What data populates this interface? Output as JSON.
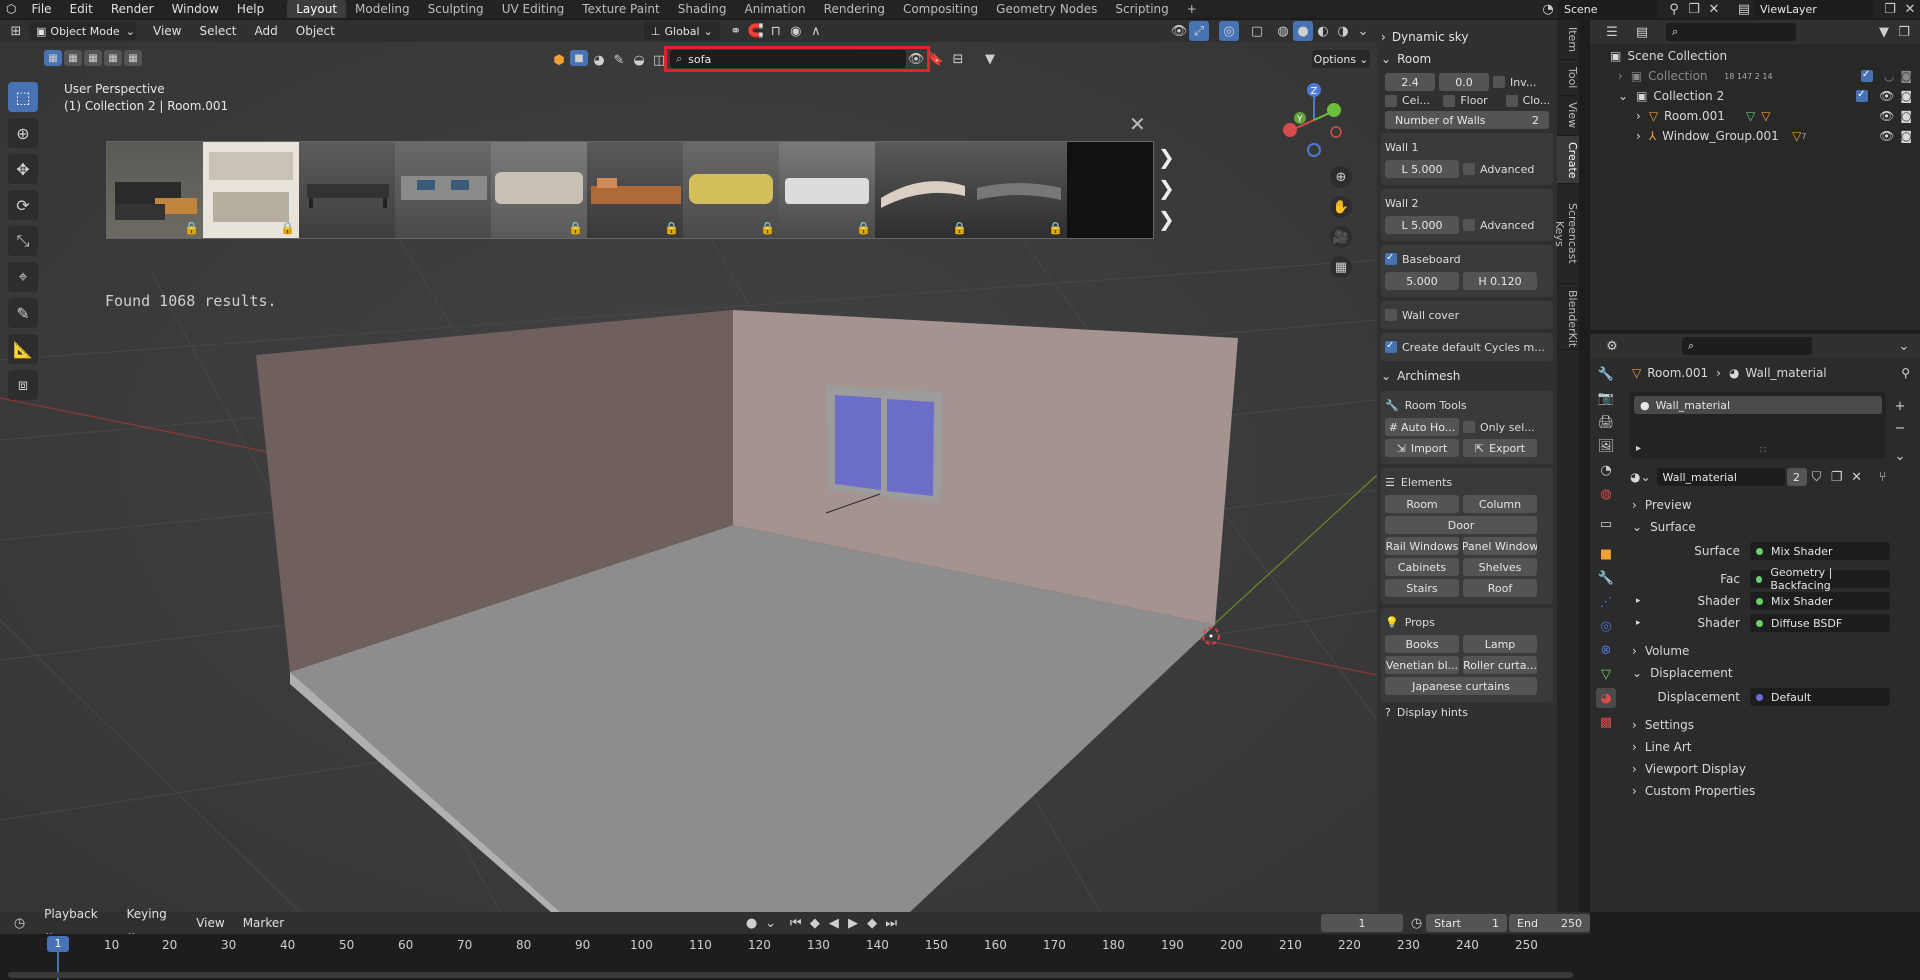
{
  "topmenu": {
    "file": "File",
    "edit": "Edit",
    "render": "Render",
    "window": "Window",
    "help": "Help"
  },
  "workspaces": [
    "Layout",
    "Modeling",
    "Sculpting",
    "UV Editing",
    "Texture Paint",
    "Shading",
    "Animation",
    "Rendering",
    "Compositing",
    "Geometry Nodes",
    "Scripting"
  ],
  "scene_label": "Scene",
  "viewlayer_label": "ViewLayer",
  "header": {
    "mode": "Object Mode",
    "view": "View",
    "select": "Select",
    "add": "Add",
    "object": "Object",
    "transform": "Global",
    "options": "Options"
  },
  "search": {
    "value": "sofa"
  },
  "viewport": {
    "perspective": "User Perspective",
    "context": "(1) Collection 2 | Room.001",
    "results": "Found 1068 results."
  },
  "npanel": {
    "dynamic_sky": "Dynamic sky",
    "room": {
      "title": "Room",
      "v1": "2.4",
      "v2": "0.0",
      "inv": "Inv...",
      "ceil": "Cei...",
      "floor": "Floor",
      "clo": "Clo...",
      "walls_label": "Number of Walls",
      "walls_value": "2"
    },
    "wall1": {
      "title": "Wall 1",
      "len": "L  5.000",
      "adv": "Advanced"
    },
    "wall2": {
      "title": "Wall 2",
      "len": "L  5.000",
      "adv": "Advanced"
    },
    "baseboard": {
      "title": "Baseboard",
      "w": "5.000",
      "h": "H  0.120"
    },
    "wallcover": "Wall cover",
    "create_default": "Create default Cycles m...",
    "archimesh": "Archimesh",
    "room_tools": {
      "title": "Room Tools",
      "auto": "Auto Ho...",
      "only_sel": "Only sel...",
      "import": "Import",
      "export": "Export"
    },
    "elements": {
      "title": "Elements",
      "room": "Room",
      "column": "Column",
      "door": "Door",
      "rail": "Rail Windows",
      "panel": "Panel Window",
      "cabinets": "Cabinets",
      "shelves": "Shelves",
      "stairs": "Stairs",
      "roof": "Roof"
    },
    "props": {
      "title": "Props",
      "books": "Books",
      "lamp": "Lamp",
      "venetian": "Venetian bl...",
      "roller": "Roller curta...",
      "japanese": "Japanese curtains"
    },
    "display_hints": "Display hints"
  },
  "vtabs": [
    "Item",
    "Tool",
    "View",
    "Create",
    "Screencast Keys",
    "BlenderKit"
  ],
  "outliner": {
    "scene_collection": "Scene Collection",
    "collection": "Collection",
    "collection_counts": [
      "18",
      "147",
      "2",
      "14"
    ],
    "collection2": "Collection 2",
    "room": "Room.001",
    "window_group": "Window_Group.001",
    "window_count": "7"
  },
  "properties": {
    "breadcrumb_obj": "Room.001",
    "breadcrumb_mat": "Wall_material",
    "slot": "Wall_material",
    "material_name": "Wall_material",
    "users": "2",
    "preview": "Preview",
    "surface": "Surface",
    "surface_label": "Surface",
    "surface_val": "Mix Shader",
    "fac_label": "Fac",
    "fac_val": "Geometry | Backfacing",
    "shader1_label": "Shader",
    "shader1_val": "Mix Shader",
    "shader2_label": "Shader",
    "shader2_val": "Diffuse BSDF",
    "volume": "Volume",
    "displacement": "Displacement",
    "disp_label": "Displacement",
    "disp_val": "Default",
    "settings": "Settings",
    "line_art": "Line Art",
    "viewport_display": "Viewport Display",
    "custom_props": "Custom Properties"
  },
  "timeline": {
    "playback": "Playback",
    "keying": "Keying",
    "view": "View",
    "marker": "Marker",
    "current": "1",
    "start_label": "Start",
    "start": "1",
    "end_label": "End",
    "end": "250",
    "ruler": [
      "1",
      "10",
      "20",
      "30",
      "40",
      "50",
      "60",
      "70",
      "80",
      "90",
      "100",
      "110",
      "120",
      "130",
      "140",
      "150",
      "160",
      "170",
      "180",
      "190",
      "200",
      "210",
      "220",
      "230",
      "240",
      "250"
    ]
  },
  "colors": {
    "accent": "#4772b3",
    "highlight_red": "#e0242a",
    "wall": "#a4938e",
    "floor": "#8a8a8a"
  }
}
